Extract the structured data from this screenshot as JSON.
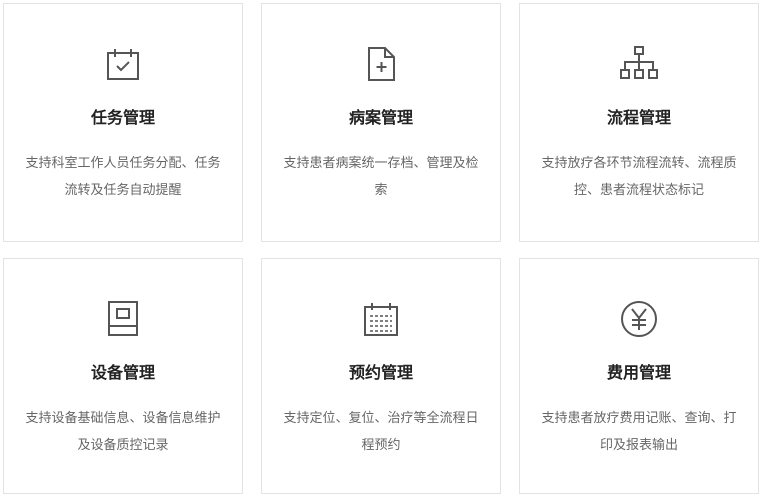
{
  "cards": [
    {
      "icon": "calendar-check-icon",
      "title": "任务管理",
      "desc": "支持科室工作人员任务分配、任务流转及任务自动提醒"
    },
    {
      "icon": "document-plus-icon",
      "title": "病案管理",
      "desc": "支持患者病案统一存档、管理及检索"
    },
    {
      "icon": "flowchart-icon",
      "title": "流程管理",
      "desc": "支持放疗各环节流程流转、流程质控、患者流程状态标记"
    },
    {
      "icon": "device-icon",
      "title": "设备管理",
      "desc": "支持设备基础信息、设备信息维护及设备质控记录"
    },
    {
      "icon": "calendar-grid-icon",
      "title": "预约管理",
      "desc": "支持定位、复位、治疗等全流程日程预约"
    },
    {
      "icon": "yen-circle-icon",
      "title": "费用管理",
      "desc": "支持患者放疗费用记账、查询、打印及报表输出"
    }
  ]
}
